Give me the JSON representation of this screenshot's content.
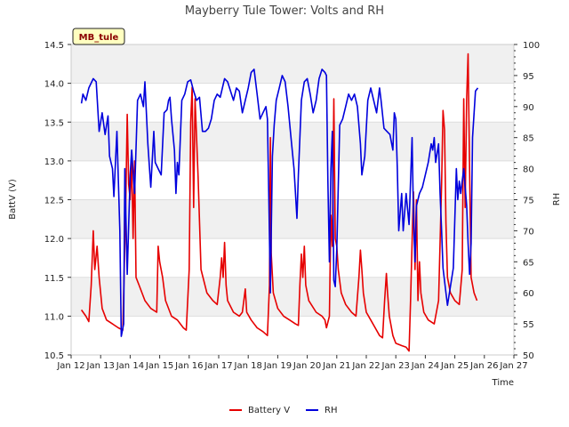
{
  "chart_data": {
    "type": "line",
    "title": "Mayberry Tule Tower: Volts and RH",
    "badge": "MB_tule",
    "xlabel": "Time",
    "ylabel": "BattV (V)",
    "y2label": "RH",
    "xlim": [
      0,
      15
    ],
    "ylim": [
      10.5,
      14.5
    ],
    "y2lim": [
      50,
      100
    ],
    "x_ticks": [
      {
        "x": 0,
        "label": "Jan 12"
      },
      {
        "x": 1,
        "label": "Jan 13"
      },
      {
        "x": 2,
        "label": "Jan 14"
      },
      {
        "x": 3,
        "label": "Jan 15"
      },
      {
        "x": 4,
        "label": "Jan 16"
      },
      {
        "x": 5,
        "label": "Jan 17"
      },
      {
        "x": 6,
        "label": "Jan 18"
      },
      {
        "x": 7,
        "label": "Jan 19"
      },
      {
        "x": 8,
        "label": "Jan 20"
      },
      {
        "x": 9,
        "label": "Jan 21"
      },
      {
        "x": 10,
        "label": "Jan 22"
      },
      {
        "x": 11,
        "label": "Jan 23"
      },
      {
        "x": 12,
        "label": "Jan 24"
      },
      {
        "x": 13,
        "label": "Jan 25"
      },
      {
        "x": 14,
        "label": "Jan 26"
      },
      {
        "x": 15,
        "label": "Jan 27"
      }
    ],
    "y_ticks": [
      10.5,
      11.0,
      11.5,
      12.0,
      12.5,
      13.0,
      13.5,
      14.0,
      14.5
    ],
    "y_tick_labels": [
      "10.5",
      "11.0",
      "11.5",
      "12.0",
      "12.5",
      "13.0",
      "13.5",
      "14.0",
      "14.5"
    ],
    "y2_ticks": [
      50,
      55,
      60,
      65,
      70,
      75,
      80,
      85,
      90,
      95,
      100
    ],
    "y2_tick_labels": [
      "50",
      "55",
      "60",
      "65",
      "70",
      "75",
      "80",
      "85",
      "90",
      "95",
      "100"
    ],
    "grid": "horizontal bands",
    "legend_position": "bottom-center",
    "series": [
      {
        "name": "Battery V",
        "axis": "left",
        "color": "#e60000",
        "points": [
          [
            0.35,
            11.08
          ],
          [
            0.5,
            11.0
          ],
          [
            0.6,
            10.93
          ],
          [
            0.68,
            11.4
          ],
          [
            0.75,
            12.1
          ],
          [
            0.8,
            11.6
          ],
          [
            0.88,
            11.9
          ],
          [
            0.95,
            11.5
          ],
          [
            1.05,
            11.1
          ],
          [
            1.2,
            10.95
          ],
          [
            1.4,
            10.9
          ],
          [
            1.6,
            10.85
          ],
          [
            1.75,
            10.82
          ],
          [
            1.85,
            12.4
          ],
          [
            1.9,
            13.6
          ],
          [
            1.95,
            12.7
          ],
          [
            2.0,
            12.5
          ],
          [
            2.05,
            13.0
          ],
          [
            2.1,
            12.0
          ],
          [
            2.15,
            13.0
          ],
          [
            2.2,
            11.5
          ],
          [
            2.3,
            11.4
          ],
          [
            2.5,
            11.2
          ],
          [
            2.7,
            11.1
          ],
          [
            2.9,
            11.05
          ],
          [
            2.95,
            11.9
          ],
          [
            3.0,
            11.7
          ],
          [
            3.1,
            11.5
          ],
          [
            3.2,
            11.2
          ],
          [
            3.4,
            11.0
          ],
          [
            3.6,
            10.95
          ],
          [
            3.8,
            10.85
          ],
          [
            3.9,
            10.82
          ],
          [
            4.0,
            11.6
          ],
          [
            4.05,
            13.5
          ],
          [
            4.1,
            13.95
          ],
          [
            4.15,
            12.4
          ],
          [
            4.2,
            13.8
          ],
          [
            4.25,
            13.3
          ],
          [
            4.3,
            12.8
          ],
          [
            4.4,
            11.6
          ],
          [
            4.6,
            11.3
          ],
          [
            4.8,
            11.2
          ],
          [
            4.95,
            11.15
          ],
          [
            5.05,
            11.5
          ],
          [
            5.1,
            11.75
          ],
          [
            5.15,
            11.5
          ],
          [
            5.2,
            11.95
          ],
          [
            5.25,
            11.4
          ],
          [
            5.3,
            11.2
          ],
          [
            5.5,
            11.05
          ],
          [
            5.7,
            11.0
          ],
          [
            5.8,
            11.05
          ],
          [
            5.9,
            11.35
          ],
          [
            5.95,
            11.05
          ],
          [
            6.1,
            10.95
          ],
          [
            6.3,
            10.85
          ],
          [
            6.5,
            10.8
          ],
          [
            6.65,
            10.75
          ],
          [
            6.72,
            11.4
          ],
          [
            6.75,
            13.3
          ],
          [
            6.78,
            11.8
          ],
          [
            6.85,
            11.3
          ],
          [
            7.0,
            11.1
          ],
          [
            7.2,
            11.0
          ],
          [
            7.4,
            10.95
          ],
          [
            7.6,
            10.9
          ],
          [
            7.7,
            10.88
          ],
          [
            7.75,
            11.4
          ],
          [
            7.8,
            11.8
          ],
          [
            7.85,
            11.5
          ],
          [
            7.9,
            11.9
          ],
          [
            7.95,
            11.4
          ],
          [
            8.05,
            11.2
          ],
          [
            8.3,
            11.05
          ],
          [
            8.5,
            11.0
          ],
          [
            8.6,
            10.95
          ],
          [
            8.65,
            10.85
          ],
          [
            8.75,
            11.0
          ],
          [
            8.8,
            12.3
          ],
          [
            8.85,
            11.9
          ],
          [
            8.9,
            13.8
          ],
          [
            8.95,
            12.0
          ],
          [
            9.0,
            11.9
          ],
          [
            9.05,
            11.6
          ],
          [
            9.15,
            11.3
          ],
          [
            9.3,
            11.15
          ],
          [
            9.5,
            11.05
          ],
          [
            9.65,
            11.0
          ],
          [
            9.75,
            11.5
          ],
          [
            9.8,
            11.85
          ],
          [
            9.85,
            11.6
          ],
          [
            9.9,
            11.3
          ],
          [
            10.0,
            11.05
          ],
          [
            10.15,
            10.95
          ],
          [
            10.3,
            10.85
          ],
          [
            10.45,
            10.75
          ],
          [
            10.55,
            10.72
          ],
          [
            10.62,
            11.2
          ],
          [
            10.68,
            11.55
          ],
          [
            10.72,
            11.3
          ],
          [
            10.78,
            11.0
          ],
          [
            10.9,
            10.75
          ],
          [
            11.0,
            10.65
          ],
          [
            11.2,
            10.62
          ],
          [
            11.35,
            10.6
          ],
          [
            11.45,
            10.55
          ],
          [
            11.5,
            11.2
          ],
          [
            11.55,
            11.95
          ],
          [
            11.6,
            12.6
          ],
          [
            11.65,
            11.6
          ],
          [
            11.7,
            12.5
          ],
          [
            11.75,
            11.2
          ],
          [
            11.8,
            11.7
          ],
          [
            11.85,
            11.3
          ],
          [
            11.95,
            11.05
          ],
          [
            12.1,
            10.95
          ],
          [
            12.3,
            10.9
          ],
          [
            12.45,
            11.2
          ],
          [
            12.55,
            12.7
          ],
          [
            12.6,
            13.65
          ],
          [
            12.65,
            13.4
          ],
          [
            12.7,
            12.2
          ],
          [
            12.75,
            11.5
          ],
          [
            12.85,
            11.3
          ],
          [
            13.0,
            11.2
          ],
          [
            13.15,
            11.15
          ],
          [
            13.25,
            11.6
          ],
          [
            13.3,
            13.8
          ],
          [
            13.35,
            12.4
          ],
          [
            13.4,
            13.8
          ],
          [
            13.45,
            14.38
          ],
          [
            13.5,
            12.9
          ],
          [
            13.55,
            11.5
          ],
          [
            13.65,
            11.3
          ],
          [
            13.75,
            11.2
          ]
        ]
      },
      {
        "name": "RH",
        "axis": "right",
        "color": "#0000dd",
        "points": [
          [
            0.35,
            90.5
          ],
          [
            0.4,
            92
          ],
          [
            0.5,
            91
          ],
          [
            0.6,
            93
          ],
          [
            0.75,
            94.5
          ],
          [
            0.85,
            94
          ],
          [
            0.95,
            86
          ],
          [
            1.05,
            89
          ],
          [
            1.15,
            85.5
          ],
          [
            1.25,
            88.5
          ],
          [
            1.3,
            82
          ],
          [
            1.4,
            80
          ],
          [
            1.45,
            75.5
          ],
          [
            1.55,
            86
          ],
          [
            1.65,
            70
          ],
          [
            1.7,
            53
          ],
          [
            1.78,
            55
          ],
          [
            1.82,
            80
          ],
          [
            1.9,
            63
          ],
          [
            2.0,
            79
          ],
          [
            2.05,
            83
          ],
          [
            2.15,
            76
          ],
          [
            2.25,
            91
          ],
          [
            2.35,
            92
          ],
          [
            2.45,
            90
          ],
          [
            2.5,
            94
          ],
          [
            2.6,
            84
          ],
          [
            2.7,
            77
          ],
          [
            2.8,
            86
          ],
          [
            2.85,
            81
          ],
          [
            2.95,
            80
          ],
          [
            3.05,
            79
          ],
          [
            3.15,
            89
          ],
          [
            3.25,
            89.5
          ],
          [
            3.3,
            91
          ],
          [
            3.35,
            91.5
          ],
          [
            3.4,
            88
          ],
          [
            3.5,
            83
          ],
          [
            3.55,
            76
          ],
          [
            3.6,
            81
          ],
          [
            3.65,
            79
          ],
          [
            3.75,
            91
          ],
          [
            3.85,
            92
          ],
          [
            3.95,
            94
          ],
          [
            4.05,
            94.3
          ],
          [
            4.15,
            92.5
          ],
          [
            4.25,
            91
          ],
          [
            4.35,
            91.5
          ],
          [
            4.45,
            86
          ],
          [
            4.55,
            86
          ],
          [
            4.65,
            86.5
          ],
          [
            4.75,
            88
          ],
          [
            4.85,
            91
          ],
          [
            4.95,
            92
          ],
          [
            5.05,
            91.5
          ],
          [
            5.2,
            94.5
          ],
          [
            5.3,
            94
          ],
          [
            5.4,
            92.5
          ],
          [
            5.5,
            91
          ],
          [
            5.6,
            93
          ],
          [
            5.7,
            92.5
          ],
          [
            5.8,
            89
          ],
          [
            5.9,
            91
          ],
          [
            6.0,
            93
          ],
          [
            6.1,
            95.5
          ],
          [
            6.2,
            96
          ],
          [
            6.3,
            92
          ],
          [
            6.4,
            88
          ],
          [
            6.5,
            89
          ],
          [
            6.6,
            90
          ],
          [
            6.65,
            88
          ],
          [
            6.7,
            75
          ],
          [
            6.75,
            60
          ],
          [
            6.82,
            82
          ],
          [
            6.88,
            87
          ],
          [
            6.95,
            91
          ],
          [
            7.05,
            93
          ],
          [
            7.15,
            95
          ],
          [
            7.25,
            94
          ],
          [
            7.35,
            90
          ],
          [
            7.45,
            85
          ],
          [
            7.55,
            80
          ],
          [
            7.65,
            72
          ],
          [
            7.7,
            79
          ],
          [
            7.8,
            91
          ],
          [
            7.9,
            94
          ],
          [
            8.0,
            94.5
          ],
          [
            8.1,
            92
          ],
          [
            8.2,
            89
          ],
          [
            8.3,
            91
          ],
          [
            8.4,
            94.5
          ],
          [
            8.5,
            96
          ],
          [
            8.6,
            95.5
          ],
          [
            8.65,
            95
          ],
          [
            8.7,
            78
          ],
          [
            8.75,
            65
          ],
          [
            8.8,
            80
          ],
          [
            8.85,
            86
          ],
          [
            8.9,
            62
          ],
          [
            8.95,
            61
          ],
          [
            9.0,
            67
          ],
          [
            9.1,
            87
          ],
          [
            9.2,
            88
          ],
          [
            9.3,
            90
          ],
          [
            9.4,
            92
          ],
          [
            9.5,
            91
          ],
          [
            9.6,
            92
          ],
          [
            9.7,
            90
          ],
          [
            9.8,
            84
          ],
          [
            9.85,
            79
          ],
          [
            9.95,
            82
          ],
          [
            10.05,
            91
          ],
          [
            10.15,
            93
          ],
          [
            10.25,
            91
          ],
          [
            10.35,
            89
          ],
          [
            10.45,
            93
          ],
          [
            10.5,
            91
          ],
          [
            10.6,
            86.5
          ],
          [
            10.7,
            86
          ],
          [
            10.8,
            85.5
          ],
          [
            10.9,
            83
          ],
          [
            10.95,
            89
          ],
          [
            11.0,
            88
          ],
          [
            11.05,
            80
          ],
          [
            11.1,
            70
          ],
          [
            11.2,
            76
          ],
          [
            11.25,
            70
          ],
          [
            11.35,
            76
          ],
          [
            11.45,
            71
          ],
          [
            11.55,
            85
          ],
          [
            11.6,
            72
          ],
          [
            11.65,
            65
          ],
          [
            11.7,
            74
          ],
          [
            11.8,
            76
          ],
          [
            11.9,
            77
          ],
          [
            12.0,
            79
          ],
          [
            12.1,
            81
          ],
          [
            12.2,
            84
          ],
          [
            12.25,
            83
          ],
          [
            12.3,
            85
          ],
          [
            12.35,
            81
          ],
          [
            12.45,
            84
          ],
          [
            12.5,
            76
          ],
          [
            12.55,
            70
          ],
          [
            12.6,
            64
          ],
          [
            12.7,
            60
          ],
          [
            12.75,
            58
          ],
          [
            12.85,
            61
          ],
          [
            12.95,
            64
          ],
          [
            13.05,
            80
          ],
          [
            13.1,
            75
          ],
          [
            13.15,
            78
          ],
          [
            13.2,
            76
          ],
          [
            13.3,
            80
          ],
          [
            13.4,
            74
          ],
          [
            13.45,
            68
          ],
          [
            13.5,
            63
          ],
          [
            13.55,
            68
          ],
          [
            13.6,
            85
          ],
          [
            13.7,
            92.5
          ],
          [
            13.78,
            93
          ]
        ]
      }
    ]
  }
}
